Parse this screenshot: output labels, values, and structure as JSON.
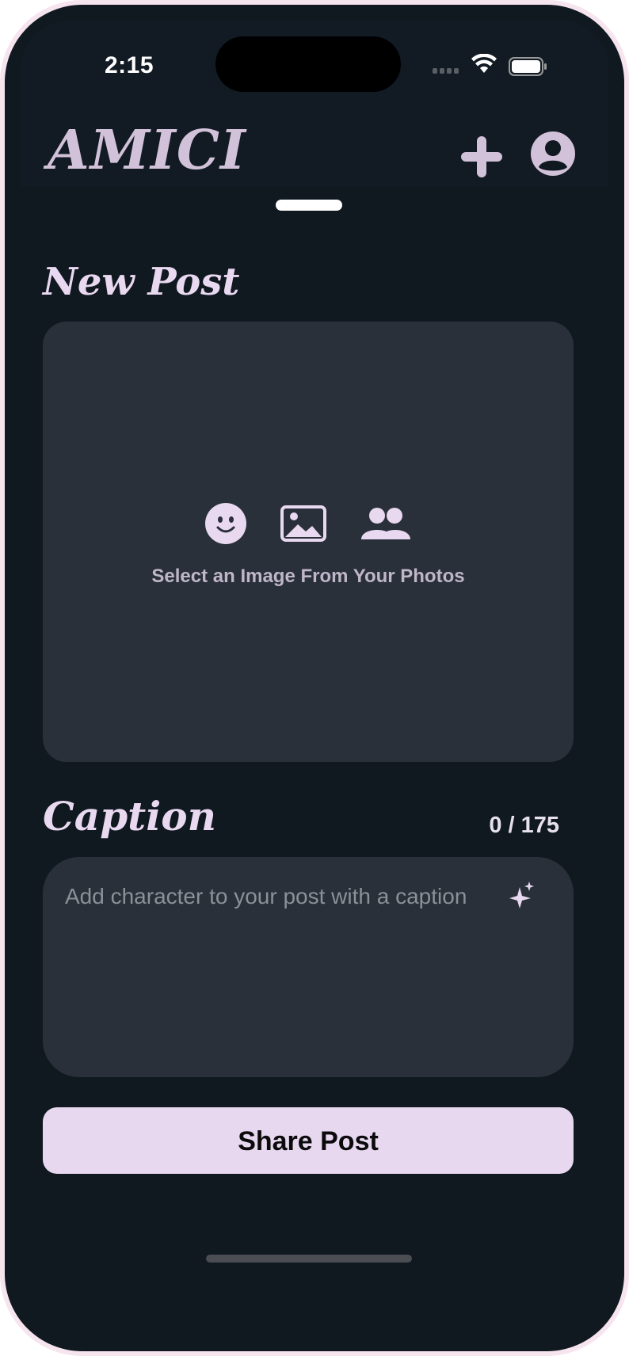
{
  "status_bar": {
    "time": "2:15",
    "icons": [
      "cellular-signal-icon",
      "wifi-icon",
      "battery-icon"
    ]
  },
  "header": {
    "logo": "AMICI",
    "icons": [
      "plus-icon",
      "profile-icon"
    ]
  },
  "new_post": {
    "title": "New Post",
    "image_picker": {
      "icons": [
        "emoji-icon",
        "photo-icon",
        "people-icon"
      ],
      "prompt": "Select an Image From Your Photos"
    }
  },
  "caption": {
    "title": "Caption",
    "char_count": "0 / 175",
    "placeholder": "Add character to your post with a caption",
    "icon": "sparkles-icon"
  },
  "share_button": {
    "label": "Share Post"
  },
  "colors": {
    "background": "#101820",
    "card": "#29303a",
    "accent": "#e7d8f0",
    "logo": "#d1c1d9",
    "device_frame": "#f6e4ee"
  }
}
